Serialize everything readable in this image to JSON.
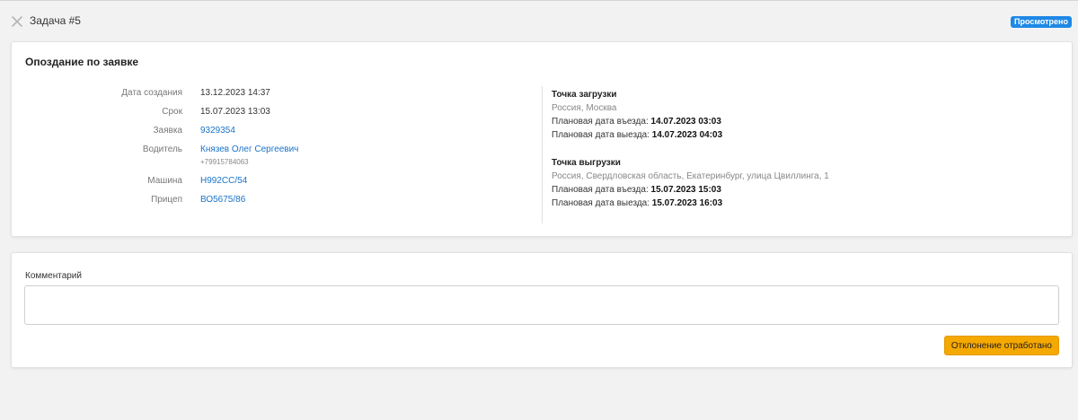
{
  "header": {
    "task_title": "Задача #5",
    "status_badge": "Просмотрено"
  },
  "card": {
    "title": "Опоздание по заявке",
    "fields": [
      {
        "label": "Дата создания",
        "value": "13.12.2023 14:37"
      },
      {
        "label": "Срок",
        "value": "15.07.2023 13:03"
      },
      {
        "label": "Заявка",
        "value": "9329354"
      },
      {
        "label": "Водитель",
        "value": "Князев Олег Сергеевич",
        "sub": "+79915784063"
      },
      {
        "label": "Машина",
        "value": "Н992СС/54"
      },
      {
        "label": "Прицеп",
        "value": "ВО5675/86"
      }
    ],
    "loading": {
      "title": "Точка загрузки",
      "address": "Россия, Москва",
      "arrival_label": "Плановая дата въезда:",
      "arrival_value": "14.07.2023 03:03",
      "departure_label": "Плановая дата выезда:",
      "departure_value": "14.07.2023 04:03"
    },
    "unloading": {
      "title": "Точка выгрузки",
      "address": "Россия, Свердловская область, Екатеринбург, улица Цвиллинга, 1",
      "arrival_label": "Плановая дата въезда:",
      "arrival_value": "15.07.2023 15:03",
      "departure_label": "Плановая дата выезда:",
      "departure_value": "15.07.2023 16:03"
    }
  },
  "comment": {
    "label": "Комментарий",
    "value": "",
    "placeholder": ""
  },
  "actions": {
    "submit_label": "Отклонение отработано"
  },
  "colors": {
    "badge": "#1e88e5",
    "link": "#1a73c8",
    "button": "#f5a800"
  }
}
